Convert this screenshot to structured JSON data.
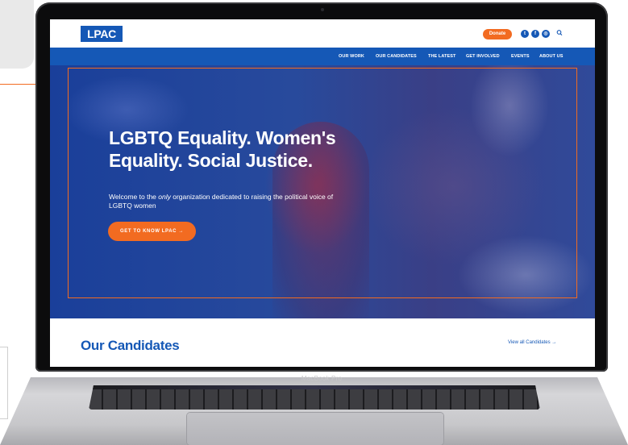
{
  "device": {
    "label": "MacBook Pro"
  },
  "header": {
    "logo_text": "LPAC",
    "donate_label": "Donate",
    "social": [
      {
        "icon": "twitter-icon",
        "glyph": "t"
      },
      {
        "icon": "facebook-icon",
        "glyph": "f"
      },
      {
        "icon": "instagram-icon",
        "glyph": "◎"
      }
    ]
  },
  "nav": {
    "items": [
      {
        "label": "OUR WORK"
      },
      {
        "label": "OUR CANDIDATES"
      },
      {
        "label": "THE LATEST"
      },
      {
        "label": "GET INVOLVED"
      },
      {
        "label": "EVENTS"
      },
      {
        "label": "ABOUT US"
      }
    ]
  },
  "hero": {
    "title": "LGBTQ Equality. Women's Equality. Social Justice.",
    "subtitle_before": "Welcome to the ",
    "subtitle_emphasis": "only",
    "subtitle_after": " organization dedicated to raising the political voice of LGBTQ women",
    "cta_label": "GET TO KNOW LPAC →"
  },
  "candidates": {
    "title": "Our Candidates",
    "view_all_label": "View all Candidates →"
  },
  "colors": {
    "brand_blue": "#1558b6",
    "accent_orange": "#f26b21",
    "laptop_black": "#0c0c0d"
  }
}
